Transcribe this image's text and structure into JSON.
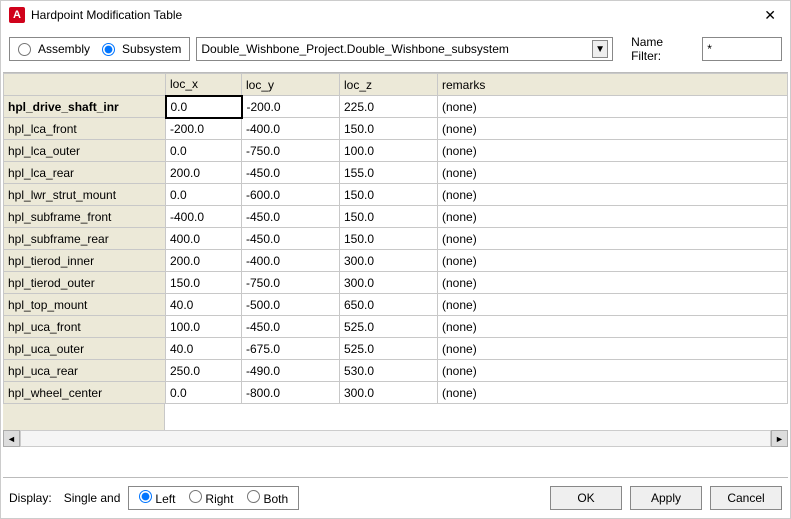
{
  "window": {
    "app_icon_glyph": "A",
    "title": "Hardpoint Modification Table"
  },
  "toolbar": {
    "scope": {
      "assembly_label": "Assembly",
      "subsystem_label": "Subsystem",
      "selected": "Subsystem"
    },
    "subsystem_selector": {
      "value": "Double_Wishbone_Project.Double_Wishbone_subsystem"
    },
    "name_filter_label": "Name Filter:",
    "name_filter_value": "*"
  },
  "table": {
    "columns": {
      "name": "",
      "loc_x": "loc_x",
      "loc_y": "loc_y",
      "loc_z": "loc_z",
      "remarks": "remarks"
    },
    "rows": [
      {
        "name": "hpl_drive_shaft_inr",
        "loc_x": "0.0",
        "loc_y": "-200.0",
        "loc_z": "225.0",
        "remarks": "(none)"
      },
      {
        "name": "hpl_lca_front",
        "loc_x": "-200.0",
        "loc_y": "-400.0",
        "loc_z": "150.0",
        "remarks": "(none)"
      },
      {
        "name": "hpl_lca_outer",
        "loc_x": "0.0",
        "loc_y": "-750.0",
        "loc_z": "100.0",
        "remarks": "(none)"
      },
      {
        "name": "hpl_lca_rear",
        "loc_x": "200.0",
        "loc_y": "-450.0",
        "loc_z": "155.0",
        "remarks": "(none)"
      },
      {
        "name": "hpl_lwr_strut_mount",
        "loc_x": "0.0",
        "loc_y": "-600.0",
        "loc_z": "150.0",
        "remarks": "(none)"
      },
      {
        "name": "hpl_subframe_front",
        "loc_x": "-400.0",
        "loc_y": "-450.0",
        "loc_z": "150.0",
        "remarks": "(none)"
      },
      {
        "name": "hpl_subframe_rear",
        "loc_x": "400.0",
        "loc_y": "-450.0",
        "loc_z": "150.0",
        "remarks": "(none)"
      },
      {
        "name": "hpl_tierod_inner",
        "loc_x": "200.0",
        "loc_y": "-400.0",
        "loc_z": "300.0",
        "remarks": "(none)"
      },
      {
        "name": "hpl_tierod_outer",
        "loc_x": "150.0",
        "loc_y": "-750.0",
        "loc_z": "300.0",
        "remarks": "(none)"
      },
      {
        "name": "hpl_top_mount",
        "loc_x": "40.0",
        "loc_y": "-500.0",
        "loc_z": "650.0",
        "remarks": "(none)"
      },
      {
        "name": "hpl_uca_front",
        "loc_x": "100.0",
        "loc_y": "-450.0",
        "loc_z": "525.0",
        "remarks": "(none)"
      },
      {
        "name": "hpl_uca_outer",
        "loc_x": "40.0",
        "loc_y": "-675.0",
        "loc_z": "525.0",
        "remarks": "(none)"
      },
      {
        "name": "hpl_uca_rear",
        "loc_x": "250.0",
        "loc_y": "-490.0",
        "loc_z": "530.0",
        "remarks": "(none)"
      },
      {
        "name": "hpl_wheel_center",
        "loc_x": "0.0",
        "loc_y": "-800.0",
        "loc_z": "300.0",
        "remarks": "(none)"
      }
    ]
  },
  "footer": {
    "display_label": "Display:",
    "mode_label": "Single and",
    "side": {
      "left_label": "Left",
      "right_label": "Right",
      "both_label": "Both",
      "selected": "Left"
    },
    "ok_label": "OK",
    "apply_label": "Apply",
    "cancel_label": "Cancel"
  }
}
